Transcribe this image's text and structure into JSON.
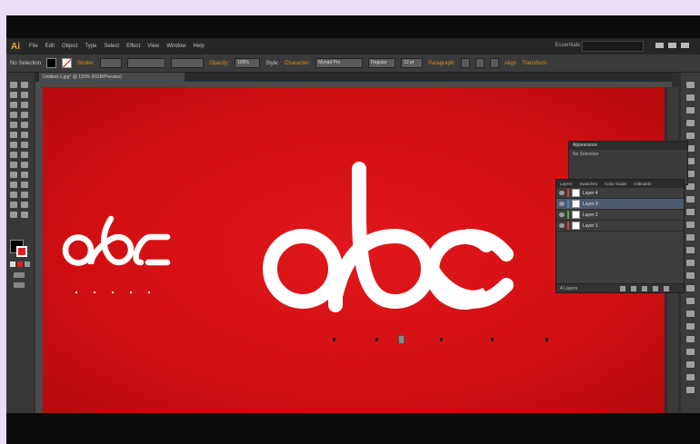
{
  "app": {
    "logo": "Ai",
    "menu": [
      "File",
      "Edit",
      "Object",
      "Type",
      "Select",
      "Effect",
      "View",
      "Window",
      "Help"
    ],
    "workspace": "Essentials"
  },
  "controlbar": {
    "no_selection": "No Selection",
    "stroke_label": "Stroke:",
    "opacity_label": "Opacity:",
    "opacity_value": "100%",
    "style_label": "Style:",
    "character_label": "Character:",
    "font_value": "Myriad Pro",
    "font_style": "Regular",
    "font_size": "12 pt",
    "paragraph_label": "Paragraph:",
    "align_label": "Align",
    "transform_label": "Transform"
  },
  "document": {
    "tab_title": "Untitled-1.jpg* @ 150% (RGB/Preview)"
  },
  "artboard": {
    "background_color": "#d8141a",
    "logo_text": "abc"
  },
  "appearance_panel": {
    "title": "Appearance",
    "subtitle": "No Selection"
  },
  "layers_panel": {
    "tabs": [
      "Layers",
      "Swatches",
      "Color Guide",
      "Artboards"
    ],
    "layers": [
      {
        "name": "Layer 4",
        "color": "#e0383c",
        "selected": false
      },
      {
        "name": "Layer 3",
        "color": "#4f7fd9",
        "selected": true
      },
      {
        "name": "Layer 2",
        "color": "#4cae4c",
        "selected": false
      },
      {
        "name": "Layer 1",
        "color": "#e0383c",
        "selected": false
      }
    ],
    "footer": "4 Layers"
  }
}
